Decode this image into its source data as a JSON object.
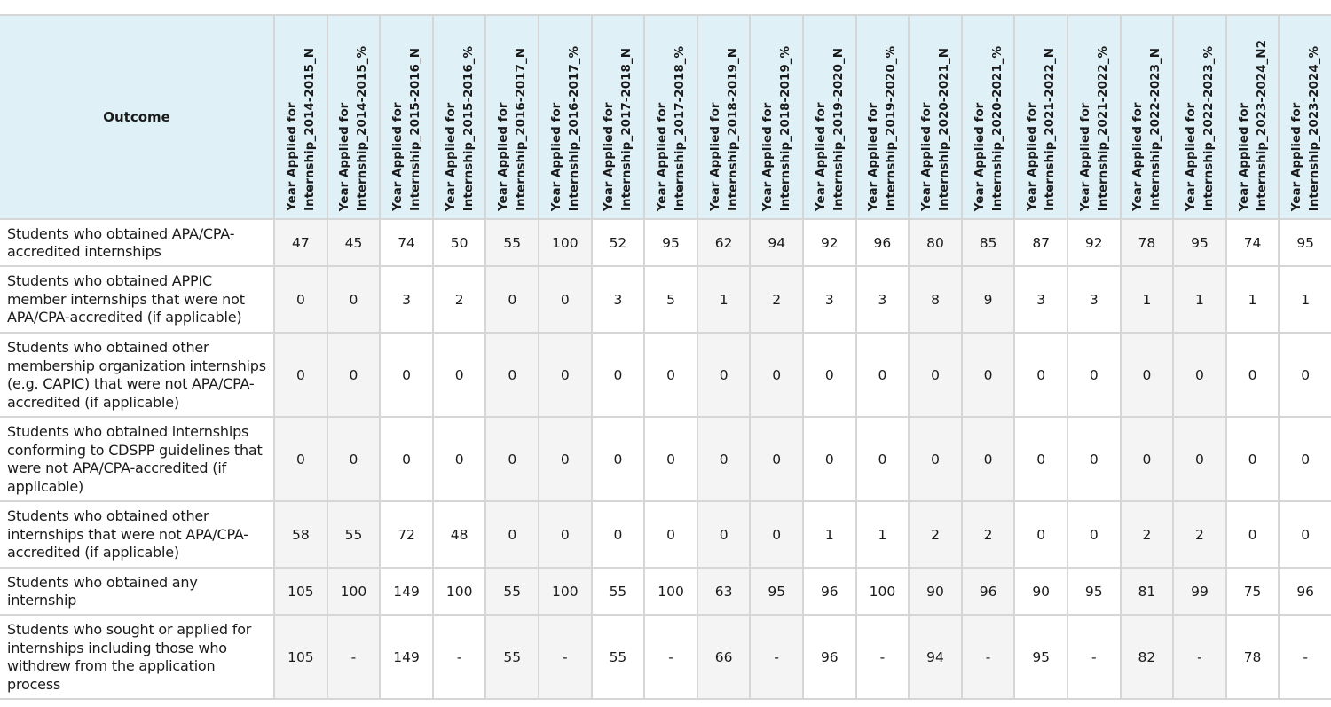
{
  "table": {
    "outcome_header": "Outcome",
    "columns": [
      {
        "line1": "Year Applied for",
        "line2": "Internship_2014-2015_N"
      },
      {
        "line1": "Year Applied for",
        "line2": "Internship_2014-2015_%"
      },
      {
        "line1": "Year Applied for",
        "line2": "Internship_2015-2016_N"
      },
      {
        "line1": "Year Applied for",
        "line2": "Internship_2015-2016_%"
      },
      {
        "line1": "Year Applied for",
        "line2": "Internship_2016-2017_N"
      },
      {
        "line1": "Year Applied for",
        "line2": "Internship_2016-2017_%"
      },
      {
        "line1": "Year Applied for",
        "line2": "Internship_2017-2018_N"
      },
      {
        "line1": "Year Applied for",
        "line2": "Internship_2017-2018_%"
      },
      {
        "line1": "Year Applied for",
        "line2": "Internship_2018-2019_N"
      },
      {
        "line1": "Year Applied for",
        "line2": "Internship_2018-2019_%"
      },
      {
        "line1": "Year Applied for",
        "line2": "Internship_2019-2020_N"
      },
      {
        "line1": "Year Applied for",
        "line2": "Internship_2019-2020_%"
      },
      {
        "line1": "Year Applied for",
        "line2": "Internship_2020-2021_N"
      },
      {
        "line1": "Year Applied for",
        "line2": "Internship_2020-2021_%"
      },
      {
        "line1": "Year Applied for",
        "line2": "Internship_2021-2022_N"
      },
      {
        "line1": "Year Applied for",
        "line2": "Internship_2021-2022_%"
      },
      {
        "line1": "Year Applied for",
        "line2": "Internship_2022-2023_N"
      },
      {
        "line1": "Year Applied for",
        "line2": "Internship_2022-2023_%"
      },
      {
        "line1": "Year Applied for",
        "line2": "Internship_2023-2024_N2"
      },
      {
        "line1": "Year Applied for",
        "line2": "Internship_2023-2024_%"
      }
    ],
    "rows": [
      {
        "label": "Students who obtained APA/CPA-accredited internships",
        "values": [
          "47",
          "45",
          "74",
          "50",
          "55",
          "100",
          "52",
          "95",
          "62",
          "94",
          "92",
          "96",
          "80",
          "85",
          "87",
          "92",
          "78",
          "95",
          "74",
          "95"
        ]
      },
      {
        "label": "Students who obtained APPIC member internships that were not APA/CPA-accredited (if applicable)",
        "values": [
          "0",
          "0",
          "3",
          "2",
          "0",
          "0",
          "3",
          "5",
          "1",
          "2",
          "3",
          "3",
          "8",
          "9",
          "3",
          "3",
          "1",
          "1",
          "1",
          "1"
        ]
      },
      {
        "label": "Students who obtained other membership organization internships (e.g. CAPIC) that were not APA/CPA-accredited (if applicable)",
        "values": [
          "0",
          "0",
          "0",
          "0",
          "0",
          "0",
          "0",
          "0",
          "0",
          "0",
          "0",
          "0",
          "0",
          "0",
          "0",
          "0",
          "0",
          "0",
          "0",
          "0"
        ]
      },
      {
        "label": "Students who obtained  internships conforming to CDSPP guidelines that were not APA/CPA-accredited (if applicable)",
        "values": [
          "0",
          "0",
          "0",
          "0",
          "0",
          "0",
          "0",
          "0",
          "0",
          "0",
          "0",
          "0",
          "0",
          "0",
          "0",
          "0",
          "0",
          "0",
          "0",
          "0"
        ]
      },
      {
        "label": "Students who obtained other internships that were not APA/CPA-accredited (if applicable)",
        "values": [
          "58",
          "55",
          "72",
          "48",
          "0",
          "0",
          "0",
          "0",
          "0",
          "0",
          "1",
          "1",
          "2",
          "2",
          "0",
          "0",
          "2",
          "2",
          "0",
          "0"
        ]
      },
      {
        "label": "Students who obtained any internship",
        "values": [
          "105",
          "100",
          "149",
          "100",
          "55",
          "100",
          "55",
          "100",
          "63",
          "95",
          "96",
          "100",
          "90",
          "96",
          "90",
          "95",
          "81",
          "99",
          "75",
          "96"
        ]
      },
      {
        "label": "Students who sought or applied for internships including those who withdrew from the application process",
        "values": [
          "105",
          "-",
          "149",
          "-",
          "55",
          "-",
          "55",
          "-",
          "66",
          "-",
          "96",
          "-",
          "94",
          "-",
          "95",
          "-",
          "82",
          "-",
          "78",
          "-"
        ]
      }
    ]
  }
}
